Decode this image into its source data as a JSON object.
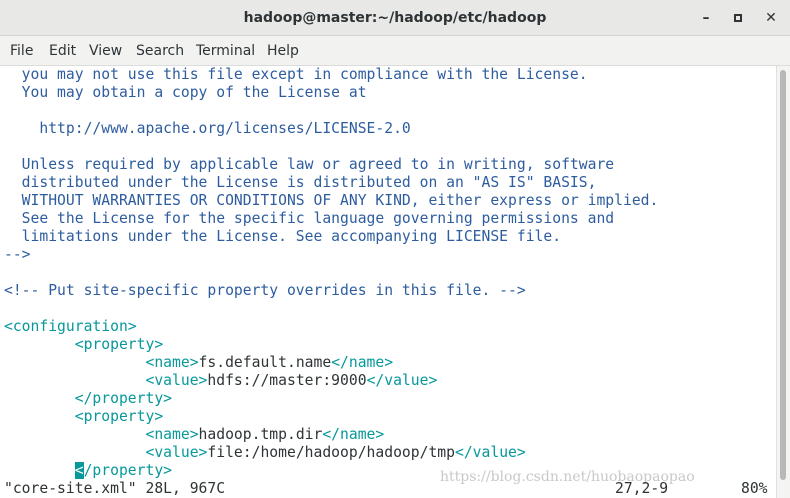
{
  "window": {
    "title": "hadoop@master:~/hadoop/etc/hadoop",
    "minimize_icon": "minimize-icon",
    "maximize_icon": "maximize-icon",
    "close_icon": "close-icon"
  },
  "menu": {
    "items": [
      "File",
      "Edit",
      "View",
      "Search",
      "Terminal",
      "Help"
    ]
  },
  "editor": {
    "lines": {
      "l1": "  you may not use this file except in compliance with the License.",
      "l2": "  You may obtain a copy of the License at",
      "l3": "    http://www.apache.org/licenses/LICENSE-2.0",
      "l4": "  Unless required by applicable law or agreed to in writing, software",
      "l5": "  distributed under the License is distributed on an \"AS IS\" BASIS,",
      "l6": "  WITHOUT WARRANTIES OR CONDITIONS OF ANY KIND, either express or implied.",
      "l7": "  See the License for the specific language governing permissions and",
      "l8": "  limitations under the License. See accompanying LICENSE file.",
      "l9": "-->",
      "l10": "<!-- Put site-specific property overrides in this file. -->",
      "l11": "<configuration>",
      "l12_open": "        <property>",
      "l13_tag_open": "<name>",
      "l13_text": "fs.default.name",
      "l13_tag_close": "</name>",
      "l14_tag_open": "<value>",
      "l14_text": "hdfs://master:9000",
      "l14_tag_close": "</value>",
      "l15": "        </property>",
      "l16": "        <property>",
      "l17_tag_open": "<name>",
      "l17_text": "hadoop.tmp.dir",
      "l17_tag_close": "</name>",
      "l18_tag_open": "<value>",
      "l18_text": "file:/home/hadoop/hadoop/tmp",
      "l18_tag_close": "</value>",
      "l19_cursor": "<",
      "l19_rest": "/property>"
    },
    "indent1": "        ",
    "indent2": "                "
  },
  "status": {
    "file_info": "\"core-site.xml\" 28L, 967C",
    "position": "27,2-9",
    "percent": "80%"
  },
  "watermark": "https://blog.csdn.net/huobaopaopao"
}
